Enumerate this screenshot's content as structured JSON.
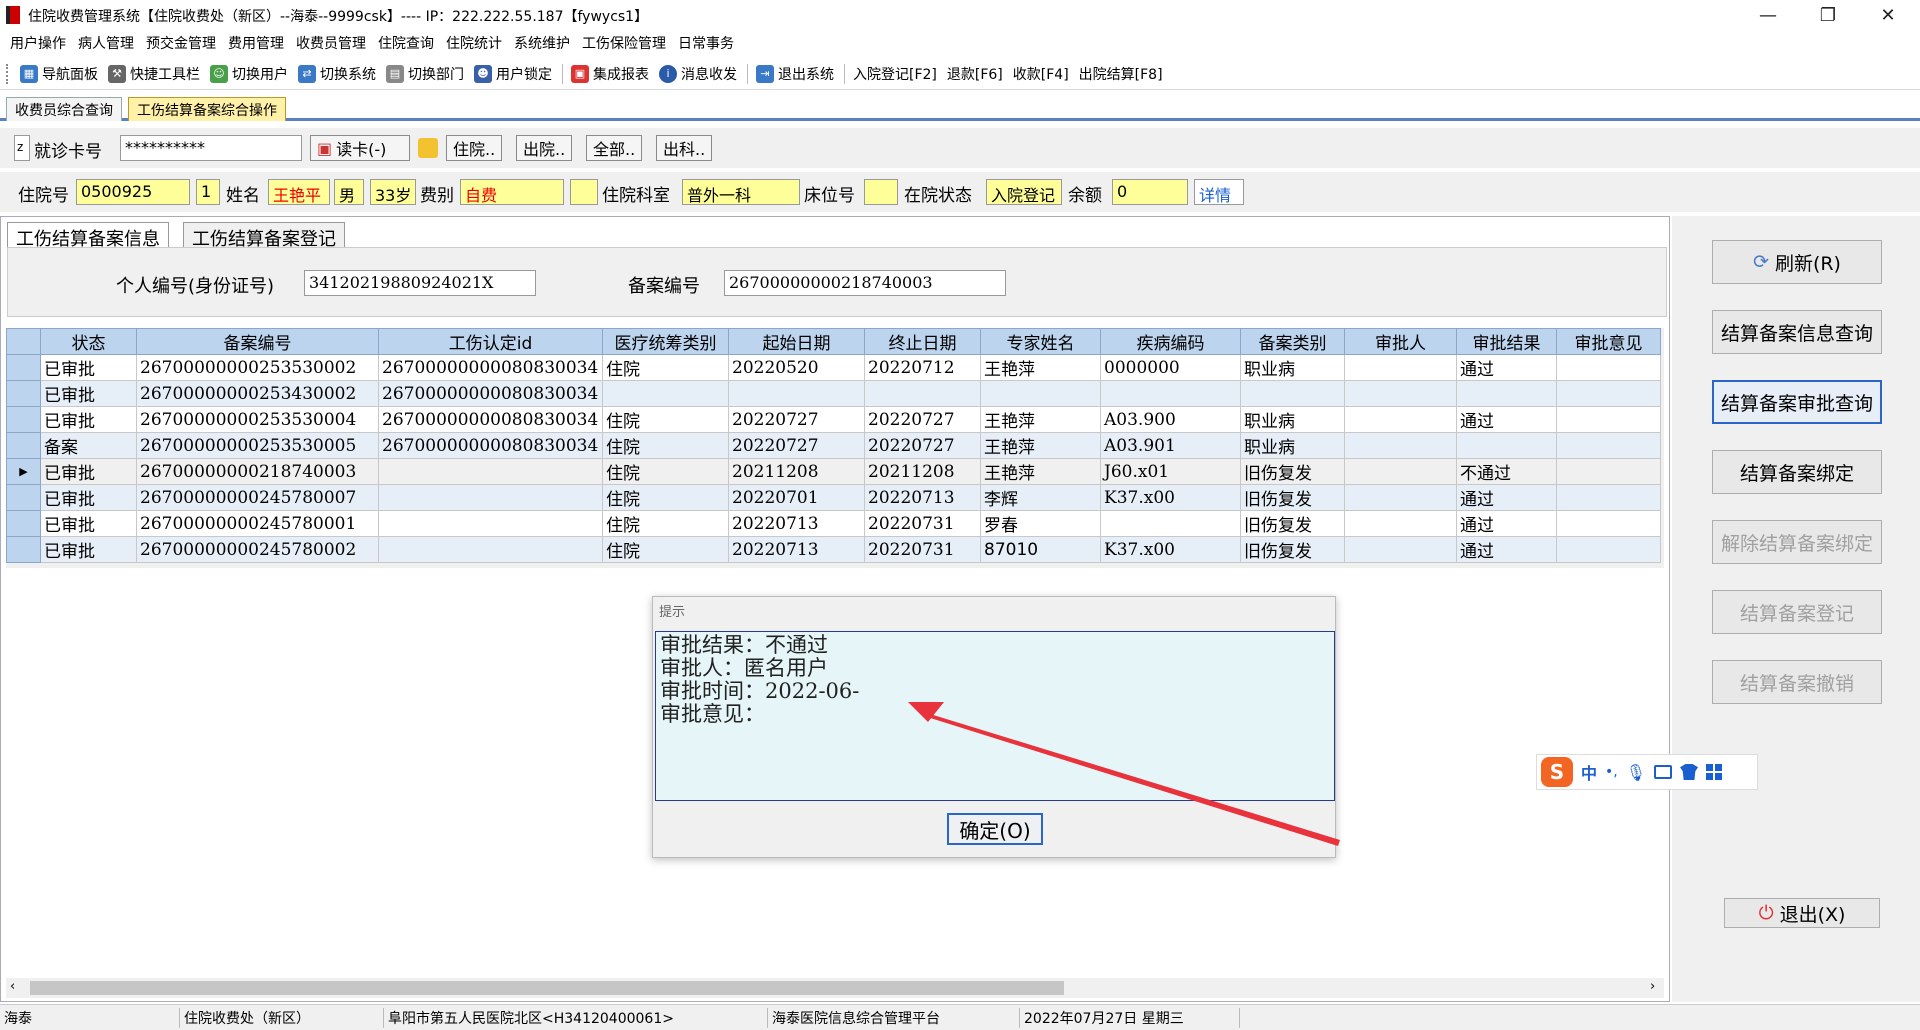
{
  "window": {
    "title": "住院收费管理系统【住院收费处（新区）--海泰--9999csk】---- IP：222.222.55.187【fywycs1】",
    "minimize": "—",
    "maximize": "❐",
    "close": "✕"
  },
  "menu": [
    "用户操作",
    "病人管理",
    "预交金管理",
    "费用管理",
    "收费员管理",
    "住院查询",
    "住院统计",
    "系统维护",
    "工伤保险管理",
    "日常事务"
  ],
  "toolbar": {
    "items": [
      "导航面板",
      "快捷工具栏",
      "切换用户",
      "切换系统",
      "切换部门",
      "用户锁定",
      "集成报表",
      "消息收发",
      "退出系统"
    ],
    "shortcuts": [
      "入院登记[F2]",
      "退款[F6]",
      "收款[F4]",
      "出院结算[F8]"
    ]
  },
  "page_tabs": [
    "收费员综合查询",
    "工伤结算备案综合操作"
  ],
  "card": {
    "z_label": "z",
    "label": "就诊卡号",
    "value": "**********",
    "read_card": "读卡(-)",
    "btn_inpatient": "住院..",
    "btn_discharged": "出院..",
    "btn_all": "全部..",
    "btn_dept": "出科.."
  },
  "patient": {
    "label_no": "住院号",
    "no": "0500925",
    "times": "1",
    "label_name": "姓名",
    "name": "王艳平",
    "sex": "男",
    "age": "33岁",
    "label_fee": "费别",
    "fee": "自费",
    "label_dept": "住院科室",
    "dept": "普外一科",
    "label_bed": "床位号",
    "bed": "",
    "label_status": "在院状态",
    "status": "入院登记",
    "label_balance": "余额",
    "balance": "0",
    "details": "详情"
  },
  "inner_tabs": [
    "工伤结算备案信息",
    "工伤结算备案登记"
  ],
  "info": {
    "label_id": "个人编号(身份证号)",
    "id_value": "34120219880924021X",
    "label_record": "备案编号",
    "record_value": "26700000000218740003"
  },
  "grid": {
    "columns": [
      "状态",
      "备案编号",
      "工伤认定id",
      "医疗统筹类别",
      "起始日期",
      "终止日期",
      "专家姓名",
      "疾病编码",
      "备案类别",
      "审批人",
      "审批结果",
      "审批意见"
    ],
    "rows": [
      [
        "已审批",
        "26700000000253530002",
        "26700000000080830034",
        "住院",
        "20220520",
        "20220712",
        "王艳萍",
        "0000000",
        "职业病",
        "",
        "通过",
        ""
      ],
      [
        "已审批",
        "26700000000253430002",
        "26700000000080830034",
        "",
        "",
        "",
        "",
        "",
        "",
        "",
        "",
        ""
      ],
      [
        "已审批",
        "26700000000253530004",
        "26700000000080830034",
        "住院",
        "20220727",
        "20220727",
        "王艳萍",
        "A03.900",
        "职业病",
        "",
        "通过",
        ""
      ],
      [
        "备案",
        "26700000000253530005",
        "26700000000080830034",
        "住院",
        "20220727",
        "20220727",
        "王艳萍",
        "A03.901",
        "职业病",
        "",
        "",
        ""
      ],
      [
        "已审批",
        "26700000000218740003",
        "",
        "住院",
        "20211208",
        "20211208",
        "王艳萍",
        "J60.x01",
        "旧伤复发",
        "",
        "不通过",
        ""
      ],
      [
        "已审批",
        "26700000000245780007",
        "",
        "住院",
        "20220701",
        "20220713",
        "李辉",
        "K37.x00",
        "旧伤复发",
        "",
        "通过",
        ""
      ],
      [
        "已审批",
        "26700000000245780001",
        "",
        "住院",
        "20220713",
        "20220731",
        "罗春",
        "",
        "旧伤复发",
        "",
        "通过",
        ""
      ],
      [
        "已审批",
        "26700000000245780002",
        "",
        "住院",
        "20220713",
        "20220731",
        "87010",
        "K37.x00",
        "旧伤复发",
        "",
        "通过",
        ""
      ]
    ],
    "selected_row": 4,
    "row_marker": "▶"
  },
  "right_buttons": [
    {
      "label": "刷新(R)",
      "disabled": false
    },
    {
      "label": "结算备案信息查询",
      "disabled": false
    },
    {
      "label": "结算备案审批查询",
      "disabled": false
    },
    {
      "label": "结算备案绑定",
      "disabled": false
    },
    {
      "label": "解除结算备案绑定",
      "disabled": true
    },
    {
      "label": "结算备案登记",
      "disabled": true
    },
    {
      "label": "结算备案撤销",
      "disabled": true
    }
  ],
  "exit_button": "退出(X)",
  "dialog": {
    "title": "提示",
    "lines": [
      "审批结果：不通过",
      "审批人：匿名用户",
      "审批时间：2022-06-",
      "审批意见："
    ],
    "ok": "确定(O)"
  },
  "ime": {
    "logo": "S",
    "items": [
      "中",
      "•,",
      "mic-icon",
      "keyboard-icon",
      "shirt-icon",
      "grid-icon"
    ]
  },
  "statusbar": [
    "海泰",
    "住院收费处（新区）",
    "阜阳市第五人民医院北区<H34120400061>",
    "海泰医院信息综合管理平台",
    "2022年07月27日 星期三"
  ],
  "colors": {
    "accent_blue": "#5a7fc2",
    "highlight_yellow": "#ffff99",
    "annotation_red": "#e8323c"
  }
}
